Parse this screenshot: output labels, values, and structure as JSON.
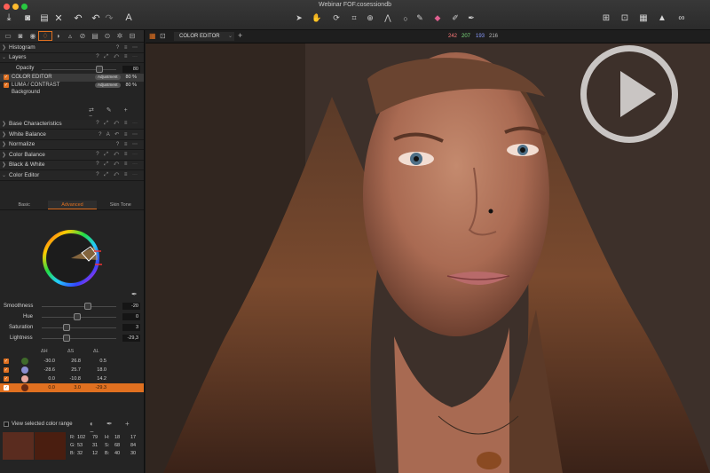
{
  "window": {
    "title": "Webinar FOF.cosessiondb"
  },
  "toolbar": {
    "left_icons": [
      "import-icon",
      "camera-icon",
      "export-icon",
      "delete-icon",
      "undo-icon",
      "redo-icon",
      "redo-alt-icon",
      "text-icon"
    ],
    "center_icons": [
      "select-icon",
      "pan-icon",
      "rotate-icon",
      "crop-icon",
      "keystone-icon",
      "straighten-icon",
      "mask-icon",
      "brush-icon",
      "eraser-icon",
      "gradient-icon",
      "color-picker-icon",
      "annotate-icon"
    ],
    "right_icons": [
      "grid-icon",
      "proof-icon",
      "layout-icon",
      "warning-icon",
      "glasses-icon"
    ]
  },
  "viewer": {
    "mode_label": "COLOR EDITOR",
    "rgb": {
      "r": "242",
      "g": "207",
      "b": "193",
      "l": "216"
    }
  },
  "sidebar": {
    "histogram": "Histogram",
    "layers": "Layers",
    "opacity_label": "Opacity",
    "opacity_value": "80",
    "layer_items": [
      {
        "name": "COLOR EDITOR",
        "type": "Adjustment",
        "pct": "80 %"
      },
      {
        "name": "LUMA / CONTRAST",
        "type": "Adjustment",
        "pct": "80 %"
      }
    ],
    "background": "Background",
    "tools": [
      "Base Characteristics",
      "White Balance",
      "Normalize",
      "Color Balance",
      "Black & White",
      "Color Editor"
    ],
    "subtabs": [
      "Basic",
      "Advanced",
      "Skin Tone"
    ],
    "sliders": [
      {
        "label": "Smoothness",
        "value": "-20",
        "pos": 0.62
      },
      {
        "label": "Hue",
        "value": "0",
        "pos": 0.48
      },
      {
        "label": "Saturation",
        "value": "3",
        "pos": 0.33
      },
      {
        "label": "Lightness",
        "value": "-29,3",
        "pos": 0.33
      }
    ],
    "table_headers": {
      "dh": "ΔH",
      "ds": "ΔS",
      "dl": "ΔL"
    },
    "color_rows": [
      {
        "color": "#3f6a2a",
        "dh": "-30.0",
        "ds": "26.8",
        "dl": "0.5",
        "selected": false
      },
      {
        "color": "#8b8fd0",
        "dh": "-28.6",
        "ds": "25.7",
        "dl": "18.0",
        "selected": false
      },
      {
        "color": "#e8a8a0",
        "dh": "0.0",
        "ds": "-10.8",
        "dl": "14.2",
        "selected": false
      },
      {
        "color": "#6a2a12",
        "dh": "0.0",
        "ds": "3.0",
        "dl": "-29.3",
        "selected": true
      }
    ],
    "view_selected": "View selected color range",
    "readout": {
      "r_label": "R:",
      "r1": "102",
      "r2": "79",
      "g_label": "G:",
      "g1": "53",
      "g2": "31",
      "b_label": "B:",
      "b1": "32",
      "b2": "12",
      "h_label": "H:",
      "h1": "18",
      "h2": "17",
      "s_label": "S:",
      "s1": "68",
      "s2": "84",
      "bb_label": "B:",
      "bb1": "40",
      "bb2": "30"
    }
  }
}
